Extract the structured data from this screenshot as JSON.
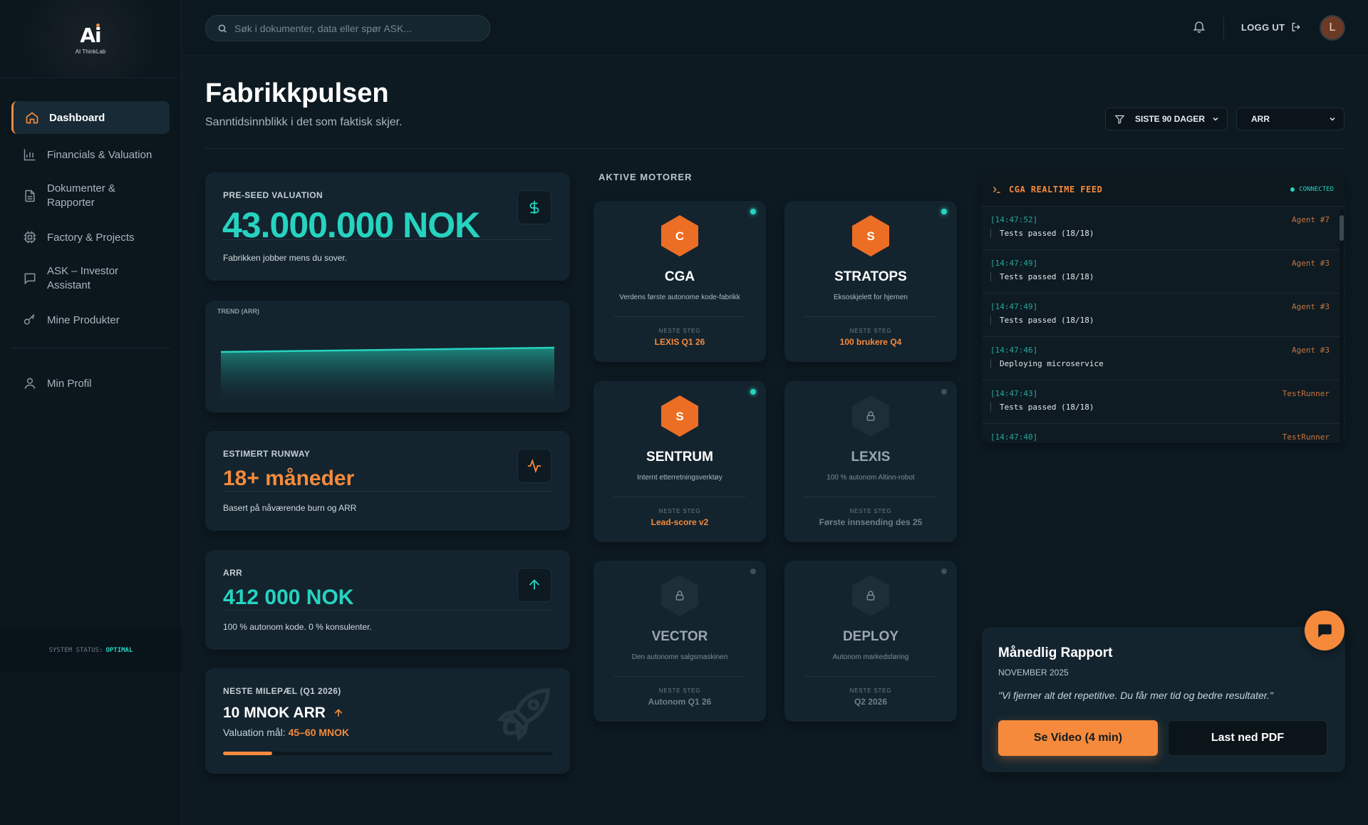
{
  "brand": {
    "logo_text": "Ai",
    "name": "AI ThinkLab"
  },
  "sidebar": {
    "items": [
      {
        "label": "Dashboard",
        "icon": "home-icon",
        "active": true
      },
      {
        "label": "Financials & Valuation",
        "icon": "bar-chart-icon"
      },
      {
        "label": "Dokumenter & Rapporter",
        "icon": "document-icon"
      },
      {
        "label": "Factory & Projects",
        "icon": "cpu-icon"
      },
      {
        "label": "ASK – Investor Assistant",
        "icon": "chat-icon"
      },
      {
        "label": "Mine Produkter",
        "icon": "key-icon"
      }
    ],
    "profile": {
      "label": "Min Profil",
      "icon": "user-icon"
    },
    "system_status_label": "SYSTEM STATUS:",
    "system_status_value": "OPTIMAL"
  },
  "topbar": {
    "search_placeholder": "Søk i dokumenter, data eller spør ASK...",
    "logout_label": "LOGG UT",
    "avatar_initial": "L"
  },
  "header": {
    "title": "Fabrikkpulsen",
    "subtitle": "Sanntidsinnblikk i det som faktisk skjer.",
    "period_filter": "SISTE 90 DAGER",
    "metric_filter": "ARR"
  },
  "kpis": {
    "valuation": {
      "label": "PRE-SEED VALUATION",
      "value": "43.000.000 NOK",
      "caption": "Fabrikken jobber mens du sover."
    },
    "trend": {
      "label": "TREND (ARR)"
    },
    "runway": {
      "label": "ESTIMERT RUNWAY",
      "value": "18+ måneder",
      "caption": "Basert på nåværende burn og ARR"
    },
    "arr": {
      "label": "ARR",
      "value": "412 000 NOK",
      "caption": "100 % autonom kode. 0 % konsulenter."
    },
    "milestone": {
      "label": "NESTE MILEPÆL (Q1 2026)",
      "value": "10 MNOK ARR",
      "target_label": "Valuation mål:",
      "target_value": "45–60 MNOK",
      "progress": 0.15
    }
  },
  "engines": {
    "title": "AKTIVE MOTORER",
    "next_label": "NESTE STEG",
    "items": [
      {
        "letter": "C",
        "name": "CGA",
        "desc": "Verdens første autonome kode-fabrikk",
        "next": "LEXIS Q1 26",
        "active": true
      },
      {
        "letter": "S",
        "name": "STRATOPS",
        "desc": "Eksoskjelett for hjernen",
        "next": "100 brukere Q4",
        "active": true
      },
      {
        "letter": "S",
        "name": "SENTRUM",
        "desc": "Internt etterretningsverktøy",
        "next": "Lead-score v2",
        "active": true
      },
      {
        "letter": "",
        "name": "LEXIS",
        "desc": "100 % autonom Altinn-robot",
        "next": "Første innsending des 25",
        "active": false
      },
      {
        "letter": "",
        "name": "VECTOR",
        "desc": "Den autonome salgsmaskinen",
        "next": "Autonom Q1 26",
        "active": false
      },
      {
        "letter": "",
        "name": "DEPLOY",
        "desc": "Autonom markedsføring",
        "next": "Q2 2026",
        "active": false
      }
    ]
  },
  "feed": {
    "title": "CGA REALTIME FEED",
    "status": "CONNECTED",
    "entries": [
      {
        "time": "[14:47:52]",
        "agent": "Agent #7",
        "msg": "Tests passed (18/18)"
      },
      {
        "time": "[14:47:49]",
        "agent": "Agent #3",
        "msg": "Tests passed (18/18)"
      },
      {
        "time": "[14:47:49]",
        "agent": "Agent #3",
        "msg": "Tests passed (18/18)"
      },
      {
        "time": "[14:47:46]",
        "agent": "Agent #3",
        "msg": "Deploying microservice"
      },
      {
        "time": "[14:47:43]",
        "agent": "TestRunner",
        "msg": "Tests passed (18/18)"
      },
      {
        "time": "[14:47:40]",
        "agent": "TestRunner",
        "msg": ""
      }
    ]
  },
  "report": {
    "title": "Månedlig Rapport",
    "date": "NOVEMBER 2025",
    "quote": "\"Vi fjerner alt det repetitive. Du får mer tid og bedre resultater.\"",
    "video_button": "Se Video (4 min)",
    "pdf_button": "Last ned PDF"
  },
  "colors": {
    "accent": "#f58a3c",
    "teal": "#26d3c0",
    "bg": "#0d1a22",
    "card": "#13242e"
  }
}
